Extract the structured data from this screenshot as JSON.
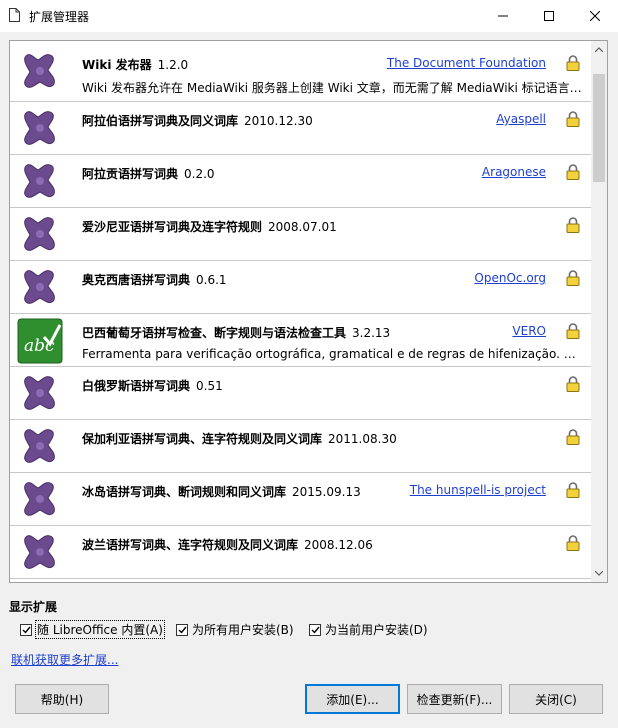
{
  "window": {
    "title": "扩展管理器"
  },
  "extensions": [
    {
      "name": "Wiki 发布器",
      "version": "1.2.0",
      "publisher": "The Document Foundation",
      "description": "Wiki 发布器允许在 MediaWiki 服务器上创建 Wiki 文章，而无需了解 MediaWiki 标记语言的细节。",
      "icon": "puzzle-icon"
    },
    {
      "name": "阿拉伯语拼写词典及同义词库",
      "version": "2010.12.30",
      "publisher": "Ayaspell",
      "description": "",
      "icon": "puzzle-icon"
    },
    {
      "name": "阿拉贡语拼写词典",
      "version": "0.2.0",
      "publisher": "Aragonese",
      "description": "",
      "icon": "puzzle-icon"
    },
    {
      "name": "爱沙尼亚语拼写词典及连字符规则",
      "version": "2008.07.01",
      "publisher": "",
      "description": "",
      "icon": "puzzle-icon"
    },
    {
      "name": "奥克西唐语拼写词典",
      "version": "0.6.1",
      "publisher": "OpenOc.org",
      "description": "",
      "icon": "puzzle-icon"
    },
    {
      "name": "巴西葡萄牙语拼写检查、断字规则与语法检查工具",
      "version": "3.2.13",
      "publisher": "VERO",
      "description": "Ferramenta para verificação ortográfica, gramatical e de regras de hifenização. Projeto VERO",
      "icon": "abc-spellcheck-icon"
    },
    {
      "name": "白俄罗斯语拼写词典",
      "version": "0.51",
      "publisher": "",
      "description": "",
      "icon": "puzzle-icon"
    },
    {
      "name": "保加利亚语拼写词典、连字符规则及同义词库",
      "version": "2011.08.30",
      "publisher": "",
      "description": "",
      "icon": "puzzle-icon"
    },
    {
      "name": "冰岛语拼写词典、断词规则和同义词库",
      "version": "2015.09.13",
      "publisher": "The hunspell-is project",
      "description": "",
      "icon": "puzzle-icon"
    },
    {
      "name": "波兰语拼写词典、连字符规则及同义词库",
      "version": "2008.12.06",
      "publisher": "",
      "description": "",
      "icon": "puzzle-icon"
    }
  ],
  "filters": {
    "label": "显示扩展",
    "bundled": "随 LibreOffice 内置(A)",
    "shared": "为所有用户安装(B)",
    "user": "为当前用户安装(D)"
  },
  "get_more_link": "联机获取更多扩展...",
  "buttons": {
    "help": "帮助(H)",
    "add": "添加(E)...",
    "check_updates": "检查更新(F)...",
    "close": "关闭(C)"
  },
  "colors": {
    "link": "#1f3fcf",
    "puzzle": "#6b4a8e",
    "accent": "#0078d7"
  }
}
